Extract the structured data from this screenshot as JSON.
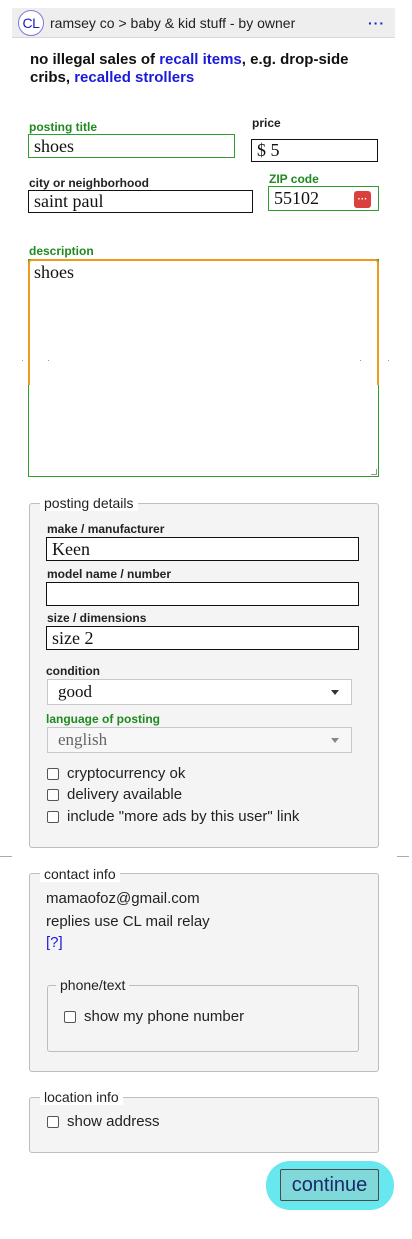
{
  "header": {
    "logo_text": "CL",
    "breadcrumb": "ramsey co > baby & kid stuff - by owner",
    "menu_label": "···"
  },
  "warning": {
    "prefix": "no illegal sales of ",
    "link1": "recall items",
    "middle": ", e.g. drop-side cribs, ",
    "link2": "recalled strollers"
  },
  "form": {
    "posting_title_label": "posting title",
    "posting_title_value": "shoes",
    "price_label": "price",
    "price_value": "$ 5",
    "city_label": "city or neighborhood",
    "city_value": "saint paul",
    "zip_label": "ZIP code",
    "zip_value": "55102",
    "zip_badge": "···",
    "description_label": "description",
    "description_value": "shoes"
  },
  "posting_details": {
    "legend": "posting details",
    "make_label": "make / manufacturer",
    "make_value": "Keen",
    "model_label": "model name / number",
    "model_value": "",
    "size_label": "size / dimensions",
    "size_value": "size 2",
    "condition_label": "condition",
    "condition_value": "good",
    "language_label": "language of posting",
    "language_value": "english",
    "checkboxes": [
      "cryptocurrency ok",
      "delivery available",
      "include \"more ads by this user\" link"
    ]
  },
  "contact_info": {
    "legend": "contact info",
    "email": "mamaofoz@gmail.com",
    "relay_text": "replies use CL mail relay",
    "help_link": "[?]",
    "phone_legend": "phone/text",
    "phone_checkbox": "show my phone number"
  },
  "location_info": {
    "legend": "location info",
    "checkbox": "show address"
  },
  "continue_label": "continue",
  "colors": {
    "green_label": "#1f8a1f",
    "link_blue": "#1a1adb",
    "focus_orange": "#ee9a1f",
    "continue_highlight": "#66e8ee",
    "zip_badge_red": "#d9413a"
  }
}
